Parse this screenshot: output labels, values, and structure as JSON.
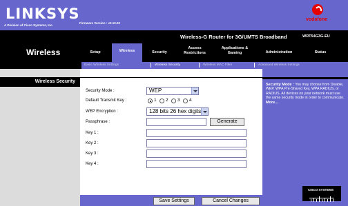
{
  "header": {
    "logo": "LINKSYS",
    "logo_sub": "A Division of Cisco Systems, Inc.",
    "firmware": "Firmware Version : v2.10.02",
    "vodafone": "vodafone",
    "product": "Wireless-G Router for 3G/UMTS Broadband",
    "model": "WRT54G3G-EU"
  },
  "section_title": "Wireless",
  "tabs": [
    {
      "label": "Setup"
    },
    {
      "label": "Wireless"
    },
    {
      "label": "Security"
    },
    {
      "label": "Access Restrictions"
    },
    {
      "label": "Applications & Gaming"
    },
    {
      "label": "Administration"
    },
    {
      "label": "Status"
    }
  ],
  "subtabs": [
    {
      "label": "Basic Wireless Settings"
    },
    {
      "label": "Wireless Security"
    },
    {
      "label": "Wireless MAC Filter"
    },
    {
      "label": "Advanced Wireless Settings"
    }
  ],
  "left_heading": "Wireless Security",
  "form": {
    "security_mode_label": "Security Mode :",
    "security_mode_value": "WEP",
    "default_key_label": "Default Transmit Key :",
    "key_options": [
      "1",
      "2",
      "3",
      "4"
    ],
    "selected_key": "1",
    "encryption_label": "WEP Encryption :",
    "encryption_value": "128 bits 26 hex digits",
    "passphrase_label": "Passphrase :",
    "generate_label": "Generate",
    "key1_label": "Key 1 :",
    "key2_label": "Key 2 :",
    "key3_label": "Key 3 :",
    "key4_label": "Key 4 :"
  },
  "help": {
    "title": "Security Mode :",
    "text": "You may choose from Disable, WEP, WPA Pre-Shared Key, WPA RADIUS, or RADIUS. All devices on your network must use the same security mode in order to communicate.",
    "more": "More..."
  },
  "cisco_label": "CISCO SYSTEMS",
  "buttons": {
    "save": "Save Settings",
    "cancel": "Cancel Changes"
  }
}
